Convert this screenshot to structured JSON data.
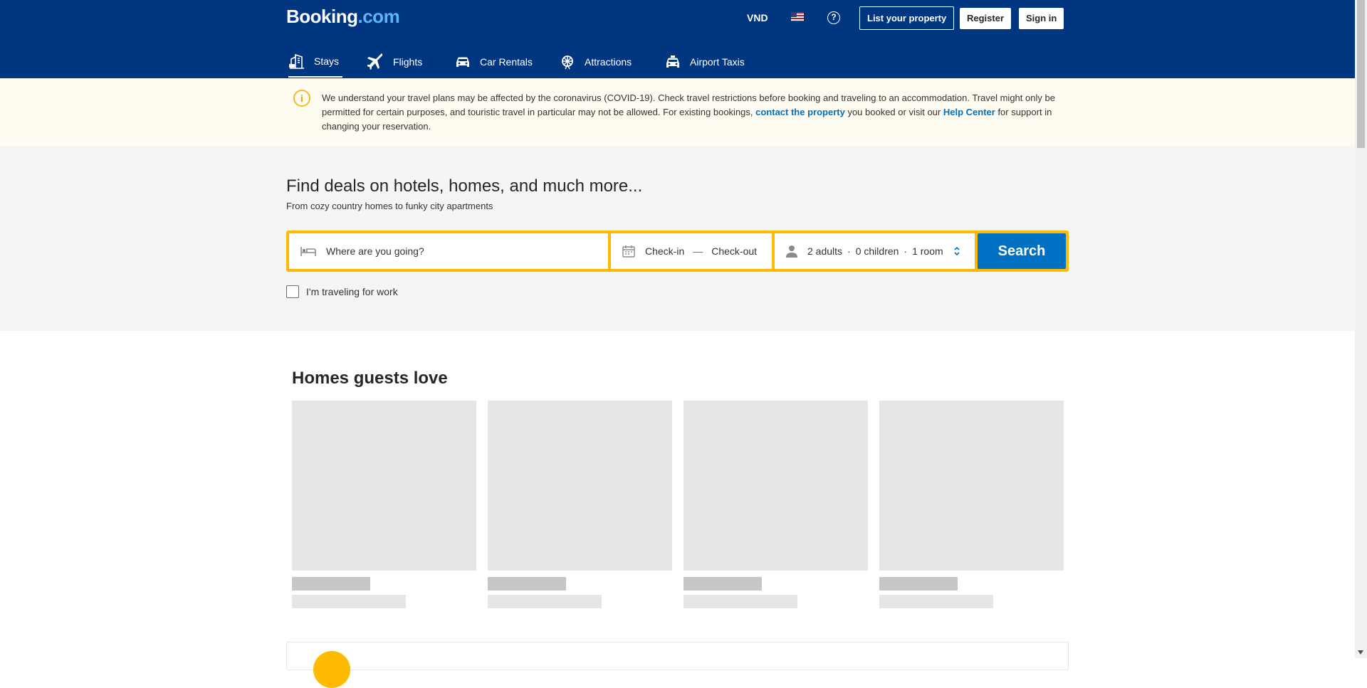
{
  "brand": {
    "name": "Booking",
    "tld": ".com"
  },
  "header": {
    "currency": "VND",
    "flag_icon": "us-flag-icon",
    "help_glyph": "?",
    "list_property": "List your property",
    "register": "Register",
    "sign_in": "Sign in"
  },
  "nav": {
    "items": [
      {
        "label": "Stays",
        "icon": "bed-building-icon"
      },
      {
        "label": "Flights",
        "icon": "plane-icon"
      },
      {
        "label": "Car Rentals",
        "icon": "car-icon"
      },
      {
        "label": "Attractions",
        "icon": "ferris-wheel-icon"
      },
      {
        "label": "Airport Taxis",
        "icon": "taxi-icon"
      }
    ]
  },
  "notice": {
    "part1": "We understand your travel plans may be affected by the coronavirus (COVID-19). Check travel restrictions before booking and traveling to an accommodation. Travel might only be permitted for certain purposes, and touristic travel in particular may not be allowed. For existing bookings, ",
    "link1": "contact the property",
    "part2": " you booked or visit our ",
    "link2": "Help Center",
    "part3": " for support in changing your reservation."
  },
  "hero": {
    "title": "Find deals on hotels, homes, and much more...",
    "subtitle": "From cozy country homes to funky city apartments"
  },
  "search": {
    "destination_placeholder": "Where are you going?",
    "checkin": "Check-in",
    "dash": "—",
    "checkout": "Check-out",
    "adults": "2 adults",
    "children": "0 children",
    "rooms": "1 room",
    "sep": "·",
    "button": "Search",
    "work_label": "I'm traveling for work"
  },
  "homes": {
    "title": "Homes guests love"
  },
  "colors": {
    "brand_blue": "#003580",
    "accent_yellow": "#febb02",
    "action_blue": "#0071c2"
  }
}
